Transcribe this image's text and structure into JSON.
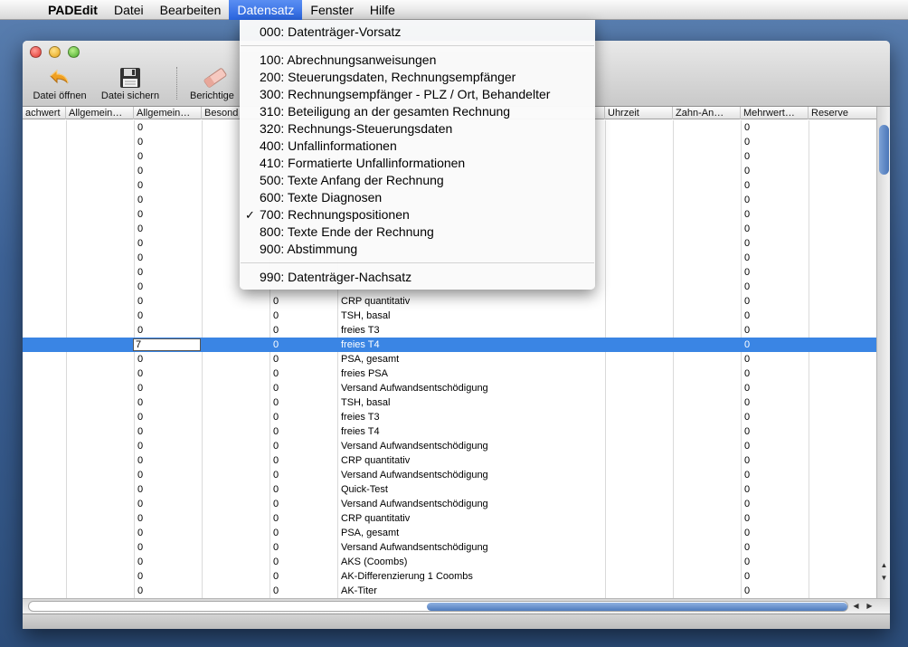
{
  "menubar": {
    "apple_icon": "apple-icon",
    "app_name": "PADEdit",
    "items": [
      "Datei",
      "Bearbeiten",
      "Datensatz",
      "Fenster",
      "Hilfe"
    ],
    "active_item": "Datensatz"
  },
  "window": {
    "toolbar": {
      "open_label": "Datei öffnen",
      "save_label": "Datei sichern",
      "correct_label": "Berichtige"
    }
  },
  "table": {
    "columns": [
      "achwert",
      "Allgemein…",
      "Allgemein…",
      "Besond",
      "",
      "",
      "",
      "",
      "Uhrzeit",
      "Zahn-An…",
      "Mehrwert…",
      "Reserve"
    ],
    "editing_value": "7",
    "selected_row": 15,
    "rows": [
      {
        "a": "0",
        "b": "",
        "c": "",
        "m": "0"
      },
      {
        "a": "0",
        "b": "",
        "c": "",
        "m": "0"
      },
      {
        "a": "0",
        "b": "",
        "c": "",
        "m": "0"
      },
      {
        "a": "0",
        "b": "",
        "c": "",
        "m": "0"
      },
      {
        "a": "0",
        "b": "",
        "c": "",
        "m": "0"
      },
      {
        "a": "0",
        "b": "",
        "c": "",
        "m": "0"
      },
      {
        "a": "0",
        "b": "",
        "c": "",
        "m": "0"
      },
      {
        "a": "0",
        "b": "",
        "c": "",
        "m": "0"
      },
      {
        "a": "0",
        "b": "",
        "c": "",
        "m": "0"
      },
      {
        "a": "0",
        "b": "",
        "c": "",
        "m": "0"
      },
      {
        "a": "0",
        "b": "",
        "c": "",
        "m": "0"
      },
      {
        "a": "0",
        "b": "",
        "c": "",
        "m": "0"
      },
      {
        "a": "0",
        "b": "0",
        "c": "CRP quantitativ",
        "m": "0"
      },
      {
        "a": "0",
        "b": "0",
        "c": "TSH, basal",
        "m": "0"
      },
      {
        "a": "0",
        "b": "0",
        "c": "freies T3",
        "m": "0"
      },
      {
        "a": "",
        "b": "0",
        "c": "freies T4",
        "m": "0"
      },
      {
        "a": "0",
        "b": "0",
        "c": "PSA, gesamt",
        "m": "0"
      },
      {
        "a": "0",
        "b": "0",
        "c": "freies PSA",
        "m": "0"
      },
      {
        "a": "0",
        "b": "0",
        "c": "Versand Aufwandsentschödigung",
        "m": "0"
      },
      {
        "a": "0",
        "b": "0",
        "c": "TSH, basal",
        "m": "0"
      },
      {
        "a": "0",
        "b": "0",
        "c": "freies T3",
        "m": "0"
      },
      {
        "a": "0",
        "b": "0",
        "c": "freies T4",
        "m": "0"
      },
      {
        "a": "0",
        "b": "0",
        "c": "Versand Aufwandsentschödigung",
        "m": "0"
      },
      {
        "a": "0",
        "b": "0",
        "c": "CRP quantitativ",
        "m": "0"
      },
      {
        "a": "0",
        "b": "0",
        "c": "Versand Aufwandsentschödigung",
        "m": "0"
      },
      {
        "a": "0",
        "b": "0",
        "c": "Quick-Test",
        "m": "0"
      },
      {
        "a": "0",
        "b": "0",
        "c": "Versand Aufwandsentschödigung",
        "m": "0"
      },
      {
        "a": "0",
        "b": "0",
        "c": "CRP quantitativ",
        "m": "0"
      },
      {
        "a": "0",
        "b": "0",
        "c": "PSA, gesamt",
        "m": "0"
      },
      {
        "a": "0",
        "b": "0",
        "c": "Versand Aufwandsentschödigung",
        "m": "0"
      },
      {
        "a": "0",
        "b": "0",
        "c": "AKS (Coombs)",
        "m": "0"
      },
      {
        "a": "0",
        "b": "0",
        "c": "AK-Differenzierung 1 Coombs",
        "m": "0"
      },
      {
        "a": "0",
        "b": "0",
        "c": "AK-Titer",
        "m": "0"
      }
    ]
  },
  "dropdown": {
    "items": [
      {
        "label": "000: Datenträger-Vorsatz",
        "checked": false,
        "sep_after": true
      },
      {
        "label": "100: Abrechnungsanweisungen",
        "checked": false,
        "sep_after": false
      },
      {
        "label": "200: Steuerungsdaten, Rechnungsempfänger",
        "checked": false,
        "sep_after": false
      },
      {
        "label": "300: Rechnungsempfänger - PLZ / Ort, Behandelter",
        "checked": false,
        "sep_after": false
      },
      {
        "label": "310: Beteiligung an der gesamten Rechnung",
        "checked": false,
        "sep_after": false
      },
      {
        "label": "320: Rechnungs-Steuerungsdaten",
        "checked": false,
        "sep_after": false
      },
      {
        "label": "400: Unfallinformationen",
        "checked": false,
        "sep_after": false
      },
      {
        "label": "410: Formatierte Unfallinformationen",
        "checked": false,
        "sep_after": false
      },
      {
        "label": "500: Texte Anfang der Rechnung",
        "checked": false,
        "sep_after": false
      },
      {
        "label": "600: Texte Diagnosen",
        "checked": false,
        "sep_after": false
      },
      {
        "label": "700: Rechnungspositionen",
        "checked": true,
        "sep_after": false
      },
      {
        "label": "800: Texte Ende der Rechnung",
        "checked": false,
        "sep_after": false
      },
      {
        "label": "900: Abstimmung",
        "checked": false,
        "sep_after": true
      },
      {
        "label": "990: Datenträger-Nachsatz",
        "checked": false,
        "sep_after": false
      }
    ],
    "check_mark": "✓"
  }
}
